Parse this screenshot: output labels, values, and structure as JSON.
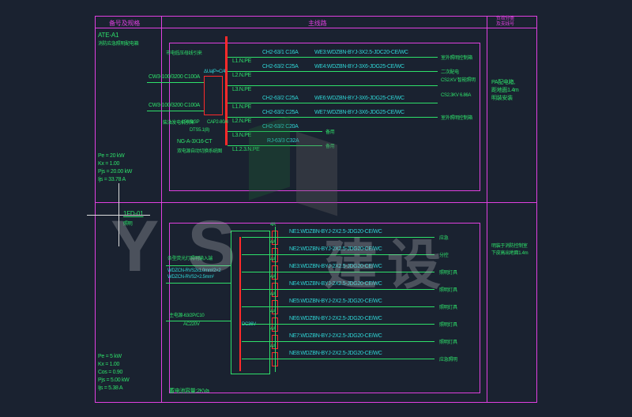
{
  "header": {
    "col1": "备号及规格",
    "col2": "主线路",
    "col3": "负荷分类\n及支线号"
  },
  "panels": {
    "top_id1": "ATE-A1",
    "top_id2": "消防应急照明配电箱",
    "top_right_note": "PA配电箱,\n距地面1.4m\n明装安装",
    "desc_in1": "市电低压母线引来",
    "sw1": "CW3-100/3200 C100A",
    "sw2": "CW3-100/3200 C100A",
    "in2_note": "柴油发电机引来",
    "rcd": "ΔUa|P=C/4",
    "sw_misc1": "158/B/3P",
    "sw_misc2": "CAP2-80/4",
    "dts": "DTS5.1(8)",
    "ct": "NG-A-3X16-CT",
    "ct_note": "双电源自动切换系统图",
    "load": {
      "pe": "Pe = 20 kW",
      "kx": "Kx = 1.00",
      "pjs": "Pjs = 20.00 kW",
      "ljs": "Ijs = 33.78 A"
    },
    "circuits": [
      {
        "ph": "L1.N.PE",
        "br": "CH2-63/1 C16A",
        "w": "WE3:WDZBN-BYJ-3X2.5-JDC20-CE/WC",
        "note": "室外照明控制箱"
      },
      {
        "ph": "L2.N.PE",
        "br": "CH2-63/2 C25A",
        "w": "WE4:WDZBN-BYJ-3X6-JDG25-CE/WC",
        "note": "二次配电"
      },
      {
        "ph": "L3.N.PE",
        "br": "",
        "w": "",
        "note": "CS2.KV 智能照明"
      },
      {
        "ph": "L1.N.PE",
        "br": "CH2-63/2 C25A",
        "w": "WE6:WDZBN-BYJ-3X6-JDG25-CE/WC",
        "note": "CS2.3KV 6.86A"
      },
      {
        "ph": "L2.N.PE",
        "br": "CH2-63/2 C25A",
        "w": "WE7:WDZBN-BYJ-3X6-JDG25-CE/WC",
        "note": "室外照明控制箱"
      },
      {
        "ph": "L3.N.PE",
        "br": "CH2-63/2 C20A",
        "w": "",
        "note": "备用"
      },
      {
        "ph": "L1.2.3.N.PE",
        "br": "RJ-63/3 C32A",
        "w": "",
        "note": "备用"
      }
    ]
  },
  "panel2": {
    "id": "1FD-01",
    "sub": "照明",
    "desc_in": "条型荧光灯照明输入端",
    "cable1": "WDZCN-RVS2x1.0mm²2×2",
    "cable2": "WDZCN-RVS2×2.5mm²",
    "main_br": "主电源-63/2P/C10",
    "ac": "AC220V",
    "dc": "DC36V",
    "rating_each": "4A",
    "load": {
      "pe": "Pe = 5 kW",
      "kx": "Kx = 1.00",
      "cos": "Cos = 0.90",
      "pjs": "Pjs = 5.00 kW",
      "ljs": "Ijs = 5.38 A"
    },
    "cap": "蓄电池容量:2KVa",
    "top_right": "明装于消防控制室\n下皮高出地面1.4m",
    "circuits": [
      {
        "w": "NE1:WDZBN-BYJ-2X2.5-JDG20-CE/WC",
        "note": "应急"
      },
      {
        "w": "NE2:WDZBN-BYJ-2X2.5-JDG20-CE/WC",
        "note": "分控"
      },
      {
        "w": "NE3:WDZBN-BYJ-2X2.5-JDG20-CE/WC",
        "note": "照明灯具"
      },
      {
        "w": "NE4:WDZBN-BYJ-2X2.5-JDG20-CE/WC",
        "note": "照明灯具"
      },
      {
        "w": "NE5:WDZBN-BYJ-2X2.5-JDG20-CE/WC",
        "note": "照明灯具"
      },
      {
        "w": "NE6:WDZBN-BYJ-2X2.5-JDG20-CE/WC",
        "note": "照明灯具"
      },
      {
        "w": "NE7:WDZBN-BYJ-2X2.5-JDG20-CE/WC",
        "note": "照明灯具"
      },
      {
        "w": "NE8:WDZBN-BYJ-2X2.5-JDG20-CE/WC",
        "note": "应急照明"
      }
    ]
  },
  "watermark": "Y  S"
}
